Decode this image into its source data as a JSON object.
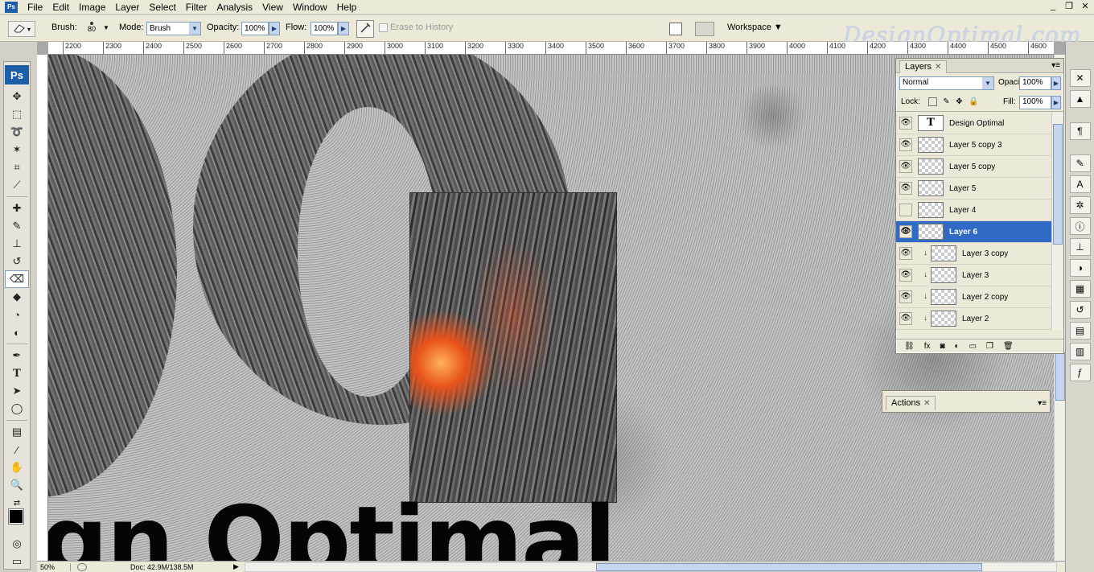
{
  "menubar": {
    "app_badge": "Ps",
    "items": [
      "File",
      "Edit",
      "Image",
      "Layer",
      "Select",
      "Filter",
      "Analysis",
      "View",
      "Window",
      "Help"
    ],
    "window_controls": [
      "_",
      "❐",
      "✕"
    ]
  },
  "options": {
    "brush_label": "Brush:",
    "brush_size": "80",
    "mode_label": "Mode:",
    "mode_value": "Brush",
    "opacity_label": "Opacity:",
    "opacity_value": "100%",
    "flow_label": "Flow:",
    "flow_value": "100%",
    "erase_history": "Erase to History",
    "workspace": "Workspace ▼",
    "watermark": "DesignOptimal.com"
  },
  "ruler": {
    "ticks": [
      "2200",
      "2300",
      "2400",
      "2500",
      "2600",
      "2700",
      "2800",
      "2900",
      "3000",
      "3100",
      "3200",
      "3300",
      "3400",
      "3500",
      "3600",
      "3700",
      "3800",
      "3900",
      "4000",
      "4100",
      "4200",
      "4300",
      "4400",
      "4500",
      "4600"
    ]
  },
  "canvas": {
    "big_text": "gn Optimal"
  },
  "status": {
    "zoom": "50%",
    "doc_size": "Doc: 42.9M/138.5M"
  },
  "layers_panel": {
    "tab": "Layers",
    "blend_mode": "Normal",
    "opacity_label": "Opacity:",
    "opacity_value": "100%",
    "lock_label": "Lock:",
    "fill_label": "Fill:",
    "fill_value": "100%",
    "layers": [
      {
        "name": "Design Optimal",
        "type": "text",
        "visible": true,
        "selected": false,
        "clipped": false
      },
      {
        "name": "Layer 5 copy 3",
        "type": "raster",
        "visible": true,
        "selected": false,
        "clipped": false
      },
      {
        "name": "Layer 5 copy",
        "type": "raster",
        "visible": true,
        "selected": false,
        "clipped": false
      },
      {
        "name": "Layer 5",
        "type": "raster",
        "visible": true,
        "selected": false,
        "clipped": false
      },
      {
        "name": "Layer 4",
        "type": "raster",
        "visible": false,
        "selected": false,
        "clipped": false
      },
      {
        "name": "Layer 6",
        "type": "raster",
        "visible": true,
        "selected": true,
        "clipped": false
      },
      {
        "name": "Layer 3 copy",
        "type": "raster",
        "visible": true,
        "selected": false,
        "clipped": true
      },
      {
        "name": "Layer 3",
        "type": "raster",
        "visible": true,
        "selected": false,
        "clipped": true
      },
      {
        "name": "Layer 2 copy",
        "type": "raster",
        "visible": true,
        "selected": false,
        "clipped": true
      },
      {
        "name": "Layer 2",
        "type": "raster",
        "visible": true,
        "selected": false,
        "clipped": true
      }
    ]
  },
  "actions_panel": {
    "tab": "Actions"
  },
  "colors": {
    "selection": "#316ac5",
    "ps_blue": "#1d5ea8"
  }
}
